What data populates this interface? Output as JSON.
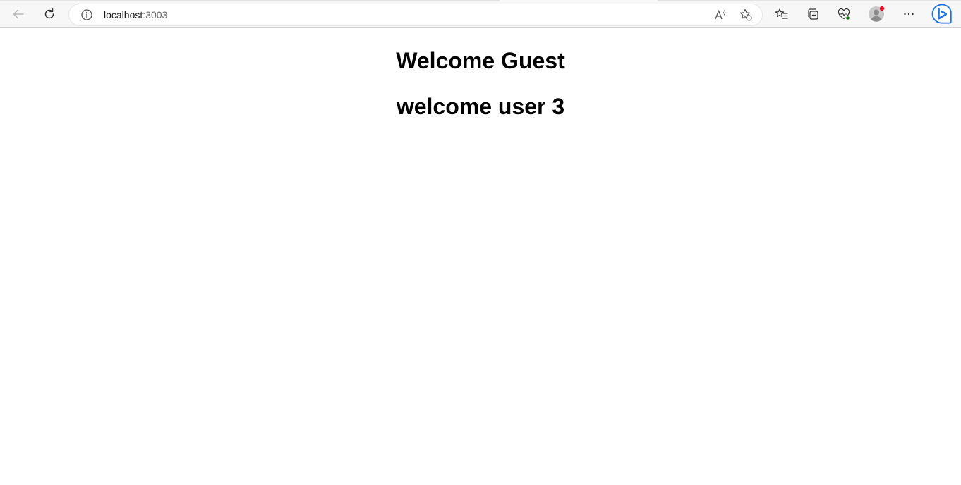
{
  "browser": {
    "address": {
      "host": "localhost",
      "port": ":3003"
    },
    "icons": {
      "back": "arrow-left-icon",
      "refresh": "refresh-icon",
      "info": "info-icon",
      "read_aloud": "read-aloud-icon",
      "add_favorite": "star-add-icon",
      "favorites": "favorites-icon",
      "collections": "collections-icon",
      "performance": "heartbeat-icon",
      "profile": "profile-avatar-icon",
      "more": "more-icon",
      "bing": "bing-icon"
    },
    "colors": {
      "toolbar_bg": "#f7f7f7",
      "bing_blue": "#1a73e8",
      "notification_dot": "#e81123",
      "health_green": "#107c10"
    }
  },
  "page": {
    "heading_guest": "Welcome Guest",
    "heading_user": "welcome user 3"
  }
}
